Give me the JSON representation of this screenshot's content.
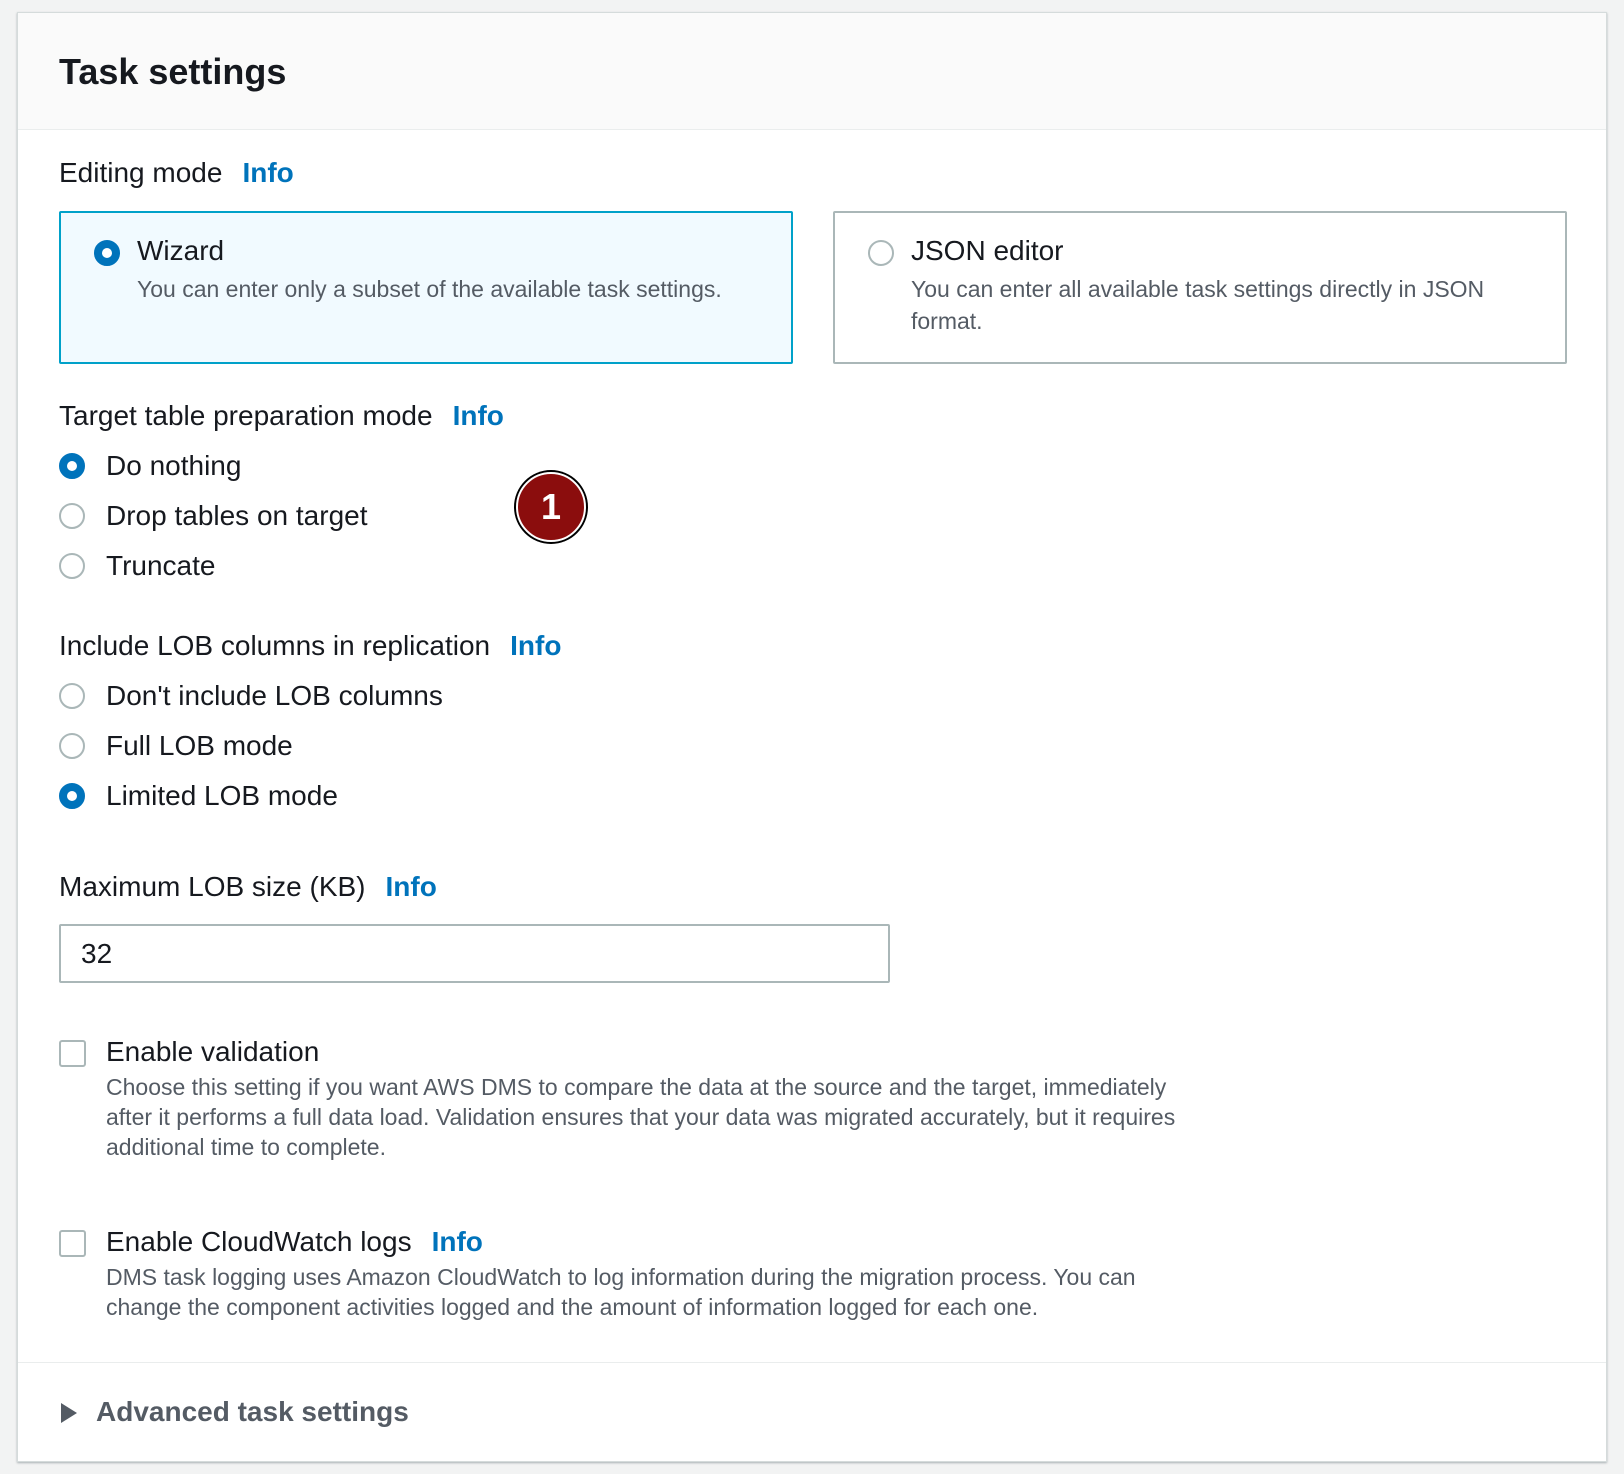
{
  "panel": {
    "title": "Task settings"
  },
  "editing_mode": {
    "label": "Editing mode",
    "info": "Info",
    "options": [
      {
        "title": "Wizard",
        "description": "You can enter only a subset of the available task settings.",
        "selected": true
      },
      {
        "title": "JSON editor",
        "description": "You can enter all available task settings directly in JSON format.",
        "selected": false
      }
    ]
  },
  "target_prep": {
    "label": "Target table preparation mode",
    "info": "Info",
    "options": [
      {
        "label": "Do nothing",
        "selected": true
      },
      {
        "label": "Drop tables on target",
        "selected": false
      },
      {
        "label": "Truncate",
        "selected": false
      }
    ]
  },
  "lob": {
    "label": "Include LOB columns in replication",
    "info": "Info",
    "options": [
      {
        "label": "Don't include LOB columns",
        "selected": false
      },
      {
        "label": "Full LOB mode",
        "selected": false
      },
      {
        "label": "Limited LOB mode",
        "selected": true
      }
    ]
  },
  "max_lob": {
    "label": "Maximum LOB size (KB)",
    "info": "Info",
    "value": "32"
  },
  "validation": {
    "label": "Enable validation",
    "checked": false,
    "description": "Choose this setting if you want AWS DMS to compare the data at the source and the target, immediately after it performs a full data load. Validation ensures that your data was migrated accurately, but it requires additional time to complete."
  },
  "cloudwatch": {
    "label": "Enable CloudWatch logs",
    "info": "Info",
    "checked": false,
    "description": "DMS task logging uses Amazon CloudWatch to log information during the migration process. You can change the component activities logged and the amount of information logged for each one."
  },
  "advanced": {
    "label": "Advanced task settings"
  },
  "annotation": {
    "number": "1"
  },
  "colors": {
    "accent": "#0073bb",
    "selected_tile_border": "#00a1c9",
    "selected_tile_bg": "#f1faff",
    "badge": "#8b0d0d"
  }
}
